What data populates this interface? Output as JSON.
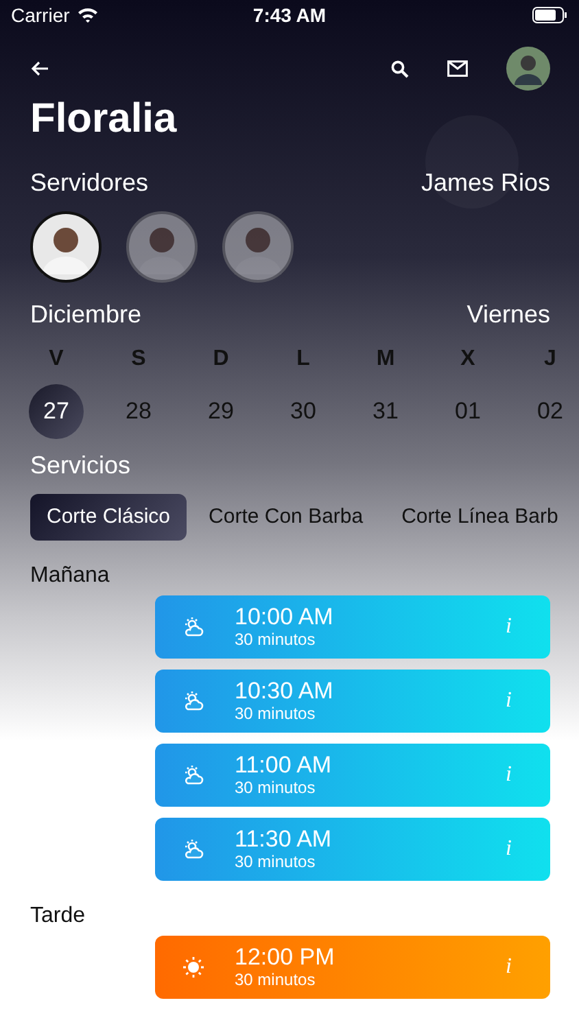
{
  "status_bar": {
    "carrier": "Carrier",
    "time": "7:43 AM"
  },
  "title": "Floralia",
  "servers": {
    "label": "Servidores",
    "selected_name": "James Rios",
    "items": [
      {
        "selected": true
      },
      {
        "selected": false
      },
      {
        "selected": false
      }
    ]
  },
  "calendar": {
    "month": "Diciembre",
    "weekday": "Viernes",
    "days": [
      {
        "letter": "V",
        "date": "27",
        "selected": true
      },
      {
        "letter": "S",
        "date": "28",
        "selected": false
      },
      {
        "letter": "D",
        "date": "29",
        "selected": false
      },
      {
        "letter": "L",
        "date": "30",
        "selected": false
      },
      {
        "letter": "M",
        "date": "31",
        "selected": false
      },
      {
        "letter": "X",
        "date": "01",
        "selected": false
      },
      {
        "letter": "J",
        "date": "02",
        "selected": false
      }
    ]
  },
  "services": {
    "label": "Servicios",
    "items": [
      {
        "label": "Corte Clásico",
        "selected": true
      },
      {
        "label": "Corte Con Barba",
        "selected": false
      },
      {
        "label": "Corte Línea Barb",
        "selected": false
      }
    ]
  },
  "sessions": [
    {
      "label": "Mañana",
      "kind": "morning",
      "slots": [
        {
          "time": "10:00 AM",
          "duration": "30 minutos",
          "info": "i"
        },
        {
          "time": "10:30 AM",
          "duration": "30 minutos",
          "info": "i"
        },
        {
          "time": "11:00 AM",
          "duration": "30 minutos",
          "info": "i"
        },
        {
          "time": "11:30 AM",
          "duration": "30 minutos",
          "info": "i"
        }
      ]
    },
    {
      "label": "Tarde",
      "kind": "afternoon",
      "slots": [
        {
          "time": "12:00 PM",
          "duration": "30 minutos",
          "info": "i"
        }
      ]
    }
  ]
}
